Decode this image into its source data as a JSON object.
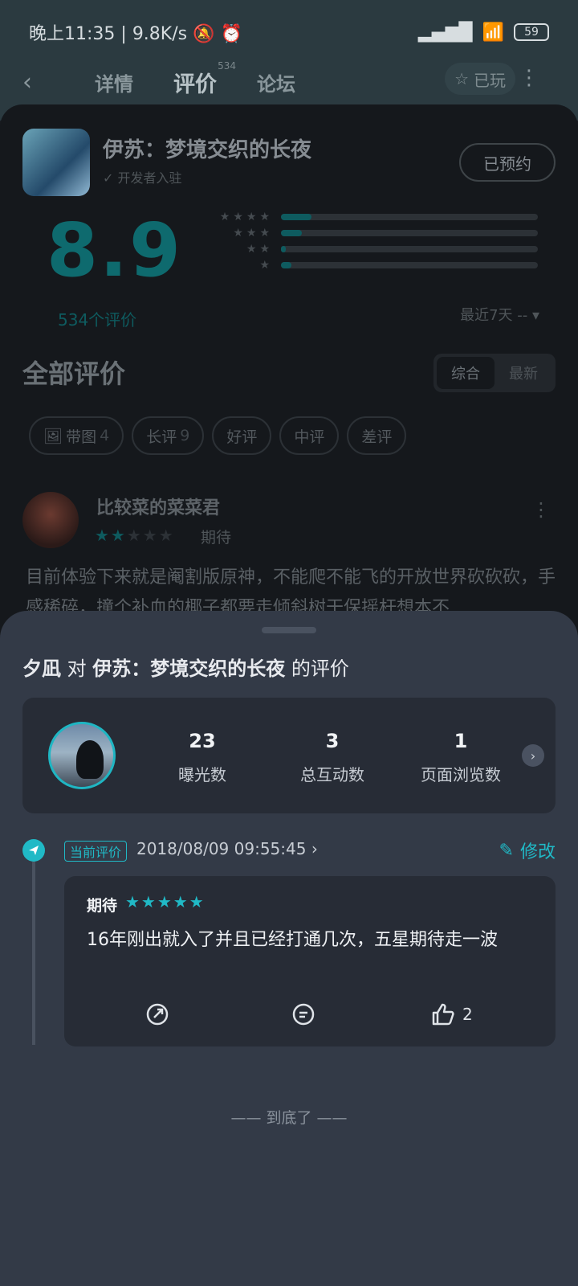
{
  "status": {
    "time": "晚上11:35",
    "speed": "9.8K/s",
    "battery": "59"
  },
  "nav": {
    "back_icon": "chevron-left-icon",
    "tabs": [
      {
        "label": "详情"
      },
      {
        "label": "评价",
        "badge": "534"
      },
      {
        "label": "论坛"
      }
    ],
    "played_label": "已玩"
  },
  "game": {
    "title": "伊苏：梦境交织的长夜",
    "dev": "开发者入驻",
    "reserve_label": "已预约"
  },
  "rating": {
    "score": "8.9",
    "count_label": "534个评价",
    "recent_label": "最近7天 -- ▾",
    "distribution": [
      {
        "stars": "★★★★",
        "fraction": 0.12
      },
      {
        "stars": "★★★",
        "fraction": 0.08
      },
      {
        "stars": "★★",
        "fraction": 0.02
      },
      {
        "stars": "★",
        "fraction": 0.04
      }
    ]
  },
  "all_reviews": {
    "title": "全部评价",
    "sort": [
      "综合",
      "最新"
    ]
  },
  "filters": [
    {
      "label": "带图",
      "count": "4"
    },
    {
      "label": "长评",
      "count": "9"
    },
    {
      "label": "好评",
      "count": ""
    },
    {
      "label": "中评",
      "count": ""
    },
    {
      "label": "差评",
      "count": ""
    }
  ],
  "bg_review": {
    "user": "比较菜的菜菜君",
    "tag": "期待",
    "stars_on": 2,
    "text": "目前体验下来就是阉割版原神，不能爬不能飞的开放世界砍砍砍，手感稀碎，撞个补血的椰子都要走倾斜树干保摇杆想本不"
  },
  "sheet": {
    "user": "夕凪",
    "mid": "对",
    "game": "伊苏：梦境交织的长夜",
    "tail": "的评价",
    "stats": [
      {
        "num": "23",
        "label": "曝光数"
      },
      {
        "num": "3",
        "label": "总互动数"
      },
      {
        "num": "1",
        "label": "页面浏览数"
      }
    ],
    "current_badge": "当前评价",
    "date": "2018/08/09 09:55:45 ›",
    "edit_label": "修改",
    "review": {
      "tag": "期待",
      "stars": "★★★★★",
      "text": "16年刚出就入了并且已经打通几次，五星期待走一波",
      "likes": "2"
    },
    "end_label": "—— 到底了 ——"
  }
}
